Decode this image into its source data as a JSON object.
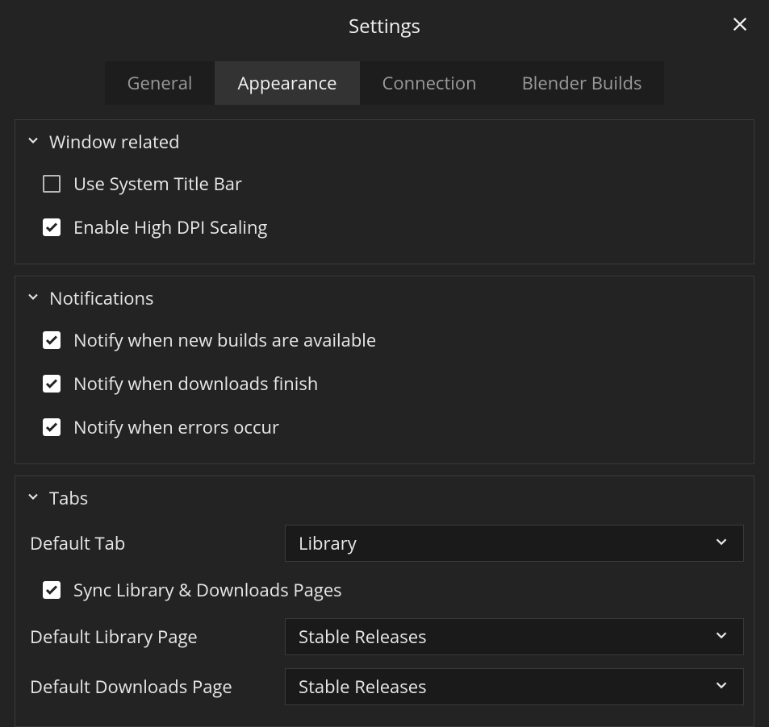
{
  "window": {
    "title": "Settings"
  },
  "tabs": {
    "items": [
      {
        "label": "General",
        "active": false
      },
      {
        "label": "Appearance",
        "active": true
      },
      {
        "label": "Connection",
        "active": false
      },
      {
        "label": "Blender Builds",
        "active": false
      }
    ]
  },
  "sections": {
    "window_related": {
      "title": "Window related",
      "options": [
        {
          "label": "Use System Title Bar",
          "checked": false
        },
        {
          "label": "Enable High DPI Scaling",
          "checked": true
        }
      ]
    },
    "notifications": {
      "title": "Notifications",
      "options": [
        {
          "label": "Notify when new builds are available",
          "checked": true
        },
        {
          "label": "Notify when downloads finish",
          "checked": true
        },
        {
          "label": "Notify when errors occur",
          "checked": true
        }
      ]
    },
    "tabs_section": {
      "title": "Tabs",
      "default_tab": {
        "label": "Default Tab",
        "value": "Library"
      },
      "sync": {
        "label": "Sync Library & Downloads Pages",
        "checked": true
      },
      "default_library": {
        "label": "Default Library Page",
        "value": "Stable Releases"
      },
      "default_downloads": {
        "label": "Default Downloads Page",
        "value": "Stable Releases"
      }
    }
  }
}
